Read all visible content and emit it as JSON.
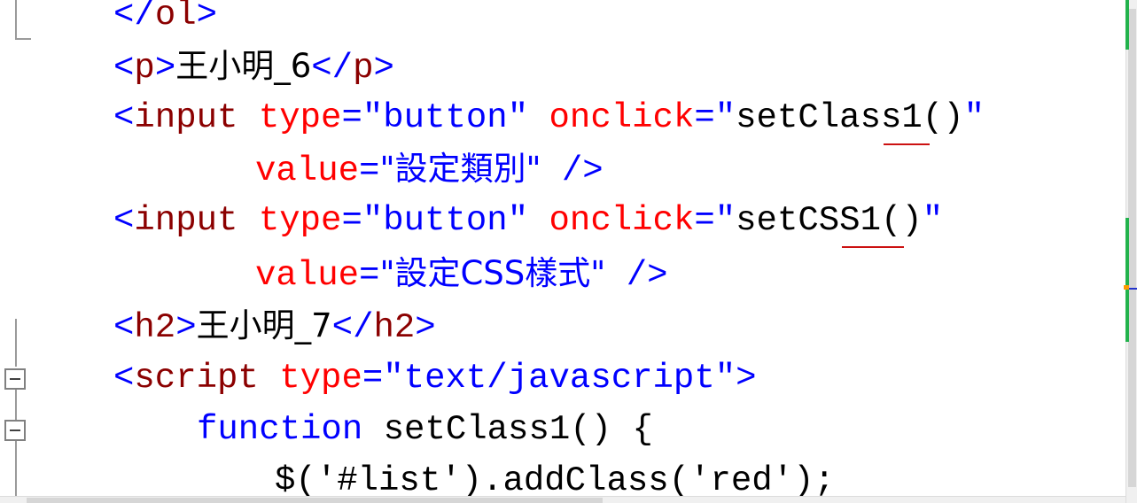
{
  "code": {
    "l1": {
      "open": "</",
      "name": "ol",
      "close": ">"
    },
    "l2": {
      "open": "<",
      "name": "p",
      "close": ">",
      "text": "王小明_6",
      "open2": "</",
      "name2": "p",
      "close2": ">"
    },
    "l3": {
      "open": "<",
      "name": "input",
      "attr1": "type",
      "eq1": "=",
      "val1": "\"button\"",
      "attr2": "onclick",
      "eq2": "=",
      "q1": "\"",
      "call": "setClass1()",
      "q2": "\""
    },
    "l4": {
      "attr": "value",
      "eq": "=",
      "val": "\"設定類別\"",
      "close": " />"
    },
    "l5": {
      "open": "<",
      "name": "input",
      "attr1": "type",
      "eq1": "=",
      "val1": "\"button\"",
      "attr2": "onclick",
      "eq2": "=",
      "q1": "\"",
      "call": "setCSS1()",
      "q2": "\""
    },
    "l6": {
      "attr": "value",
      "eq": "=",
      "val": "\"設定CSS樣式\"",
      "close": " />"
    },
    "l7": {
      "open": "<",
      "name": "h2",
      "close": ">",
      "text": "王小明_7",
      "open2": "</",
      "name2": "h2",
      "close2": ">"
    },
    "l8": {
      "open": "<",
      "name": "script",
      "attr": "type",
      "eq": "=",
      "val": "\"text/javascript\"",
      "close": ">"
    },
    "l9": {
      "kw": "function",
      "rest": " setClass1() {"
    },
    "l10": {
      "text": "$('#list').addClass('red');"
    }
  },
  "colors": {
    "tag": "#0000ff",
    "element": "#8b0000",
    "attribute": "#ff0000",
    "string": "#0000ff",
    "keyword": "#0000ff",
    "text": "#000000",
    "spellcheck": "#cc1111",
    "change_mark": "#22b24c"
  }
}
